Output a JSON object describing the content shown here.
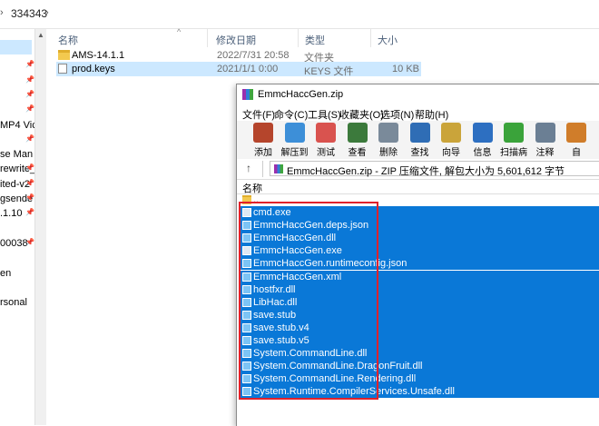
{
  "explorer": {
    "breadcrumb": "334343",
    "nav_items": [
      "",
      "",
      "",
      "",
      "",
      "MP4 Vic",
      "",
      "se Man",
      "rewrite_",
      "ited-v2",
      "gsende",
      ".1.10",
      "",
      "00038",
      "",
      "en",
      "",
      "rsonal"
    ],
    "columns": {
      "name": "名称",
      "date": "修改日期",
      "type": "类型",
      "size": "大小"
    },
    "files": [
      {
        "name": "AMS-14.1.1",
        "date": "2022/7/31 20:58",
        "type": "文件夹",
        "size": "",
        "icon": "folder-icon",
        "selected": false
      },
      {
        "name": "prod.keys",
        "date": "2021/1/1 0:00",
        "type": "KEYS 文件",
        "size": "10 KB",
        "icon": "file-icon",
        "selected": true
      }
    ]
  },
  "winrar": {
    "title": "EmmcHaccGen.zip",
    "menu": [
      "文件(F)",
      "命令(C)",
      "工具(S)",
      "收藏夹(O)",
      "选项(N)",
      "帮助(H)"
    ],
    "toolbar": [
      {
        "label": "添加",
        "icon": "add-archive-icon",
        "color": "#b5452c"
      },
      {
        "label": "解压到",
        "icon": "extract-folder-icon",
        "color": "#3d8fd8"
      },
      {
        "label": "测试",
        "icon": "test-clipboard-icon",
        "color": "#d9534f"
      },
      {
        "label": "查看",
        "icon": "view-book-icon",
        "color": "#3c7a3c"
      },
      {
        "label": "删除",
        "icon": "delete-trash-icon",
        "color": "#7a8a9a"
      },
      {
        "label": "查找",
        "icon": "find-magnifier-icon",
        "color": "#2f6db5"
      },
      {
        "label": "向导",
        "icon": "wizard-wand-icon",
        "color": "#caa43a"
      },
      {
        "label": "信息",
        "icon": "info-icon",
        "color": "#2d6fc1"
      },
      {
        "label": "扫描病毒",
        "icon": "virus-scan-icon",
        "color": "#3aa33a"
      },
      {
        "label": "注释",
        "icon": "comment-icon",
        "color": "#6b7f94"
      },
      {
        "label": "自",
        "icon": "sfx-icon",
        "color": "#d07d2a"
      }
    ],
    "path_text": "EmmcHaccGen.zip - ZIP 压缩文件, 解包大小为 5,601,612 字节",
    "list_header": "名称",
    "parent_row": "..",
    "items": [
      {
        "name": "cmd.exe",
        "kind": "exe"
      },
      {
        "name": "EmmcHaccGen.deps.json",
        "kind": "doc"
      },
      {
        "name": "EmmcHaccGen.dll",
        "kind": "doc"
      },
      {
        "name": "EmmcHaccGen.exe",
        "kind": "exe"
      },
      {
        "name": "EmmcHaccGen.runtimeconfig.json",
        "kind": "doc"
      },
      {
        "name": "EmmcHaccGen.xml",
        "kind": "doc"
      },
      {
        "name": "hostfxr.dll",
        "kind": "doc"
      },
      {
        "name": "LibHac.dll",
        "kind": "doc"
      },
      {
        "name": "save.stub",
        "kind": "doc"
      },
      {
        "name": "save.stub.v4",
        "kind": "doc"
      },
      {
        "name": "save.stub.v5",
        "kind": "doc"
      },
      {
        "name": "System.CommandLine.dll",
        "kind": "doc"
      },
      {
        "name": "System.CommandLine.DragonFruit.dll",
        "kind": "doc"
      },
      {
        "name": "System.CommandLine.Rendering.dll",
        "kind": "doc"
      },
      {
        "name": "System.Runtime.CompilerServices.Unsafe.dll",
        "kind": "doc"
      }
    ]
  },
  "colors": {
    "selection": "#0a78d7",
    "highlight_frame": "#e0212b",
    "explorer_selection": "#cce8ff"
  }
}
